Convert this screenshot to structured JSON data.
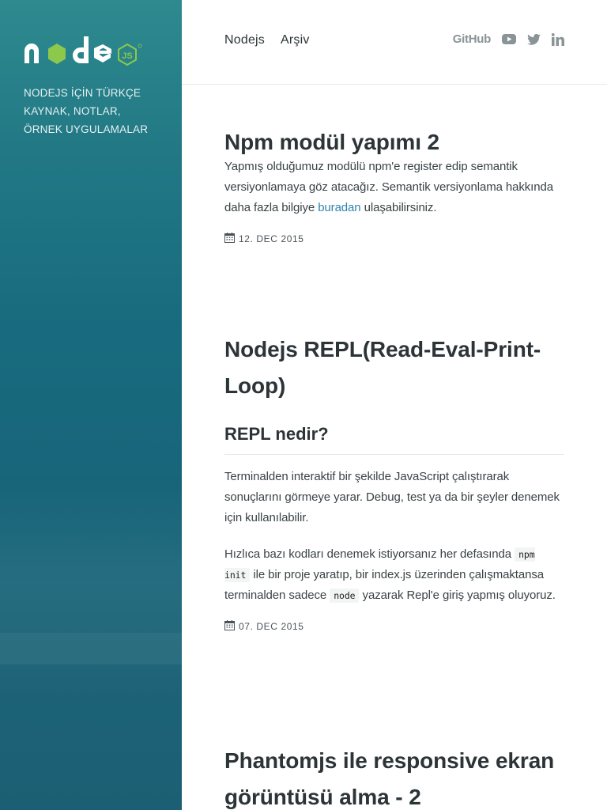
{
  "sidebar": {
    "logo_text": "node",
    "logo_badge": "JS",
    "tagline": [
      "NODEJS İÇİN TÜRKÇE",
      "KAYNAK, NOTLAR,",
      "ÖRNEK UYGULAMALAR"
    ]
  },
  "nav": {
    "items": [
      "Nodejs",
      "Arşiv"
    ]
  },
  "social": {
    "github_label": "GitHub",
    "icons": [
      "youtube-icon",
      "twitter-icon",
      "linkedin-icon"
    ]
  },
  "posts": [
    {
      "title": "Npm modül yapımı 2",
      "body_before_link": "Yapmış olduğumuz modülü npm'e register edip semantik versiyonlamaya göz atacağız. Semantik versiyonlama hakkında daha fazla bilgiye ",
      "link_text": "buradan",
      "body_after_link": " ulaşabilirsiniz.",
      "date": "12. DEC 2015"
    },
    {
      "title": "Nodejs REPL(Read-Eval-Print-Loop)",
      "subheading": "REPL nedir?",
      "para1": "Terminalden interaktif bir şekilde JavaScript çalıştırarak sonuçlarını görmeye yarar. Debug, test ya da bir şeyler denemek için kullanılabilir.",
      "para2_a": "Hızlıca bazı kodları denemek istiyorsanız her defasında ",
      "code1": "npm init",
      "para2_b": " ile bir proje yaratıp, bir index.js üzerinden çalışmaktansa terminalden sadece ",
      "code2": "node",
      "para2_c": " yazarak Repl'e giriş yapmış oluyoruz.",
      "date": "07. DEC 2015"
    },
    {
      "title": "Phantomjs ile responsive ekran görüntüsü alma - 2"
    }
  ],
  "colors": {
    "accent_link": "#2f84ad",
    "node_green": "#8cc84b",
    "sidebar": "#186b7e"
  }
}
